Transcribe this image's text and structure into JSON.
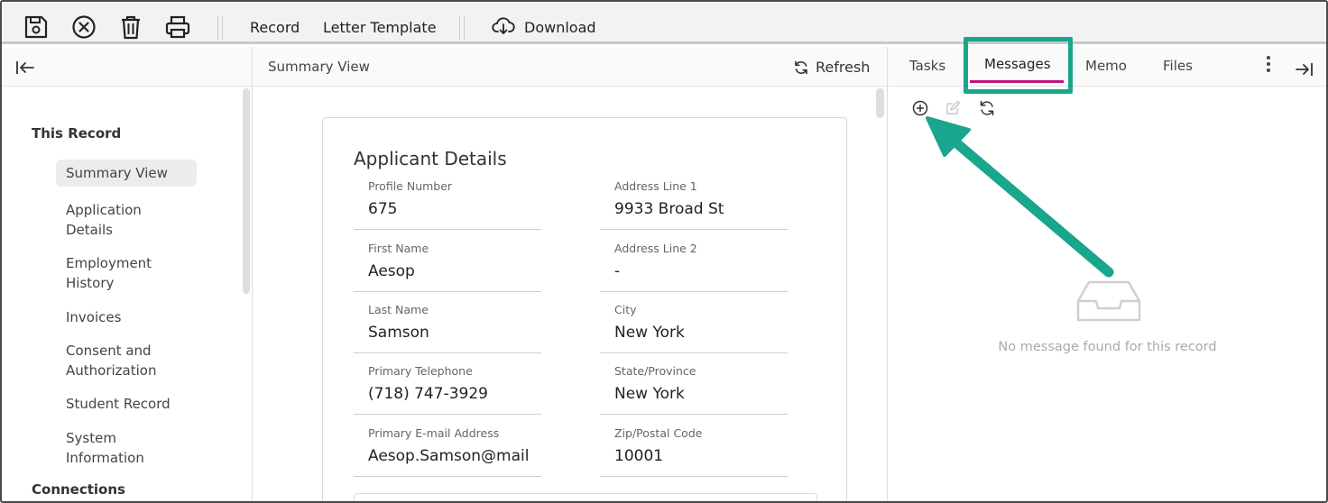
{
  "toolbar": {
    "icons": [
      "save-icon",
      "cancel-icon",
      "trash-icon",
      "print-icon",
      "cloud-download-icon"
    ],
    "record_label": "Record",
    "letter_template_label": "Letter Template",
    "download_label": "Download"
  },
  "sidebar": {
    "sections": [
      {
        "label": "This Record"
      },
      {
        "label": "Connections"
      }
    ],
    "items": [
      {
        "label": "Summary View",
        "active": true
      },
      {
        "label": "Application\nDetails"
      },
      {
        "label": "Employment\nHistory"
      },
      {
        "label": "Invoices"
      },
      {
        "label": "Consent and\nAuthorization"
      },
      {
        "label": "Student Record"
      },
      {
        "label": "System\nInformation"
      }
    ]
  },
  "main": {
    "title": "Summary View",
    "refresh_label": "Refresh",
    "card": {
      "title": "Applicant Details",
      "fields": [
        {
          "label": "Profile Number",
          "value": "675"
        },
        {
          "label": "Address Line 1",
          "value": "9933 Broad St"
        },
        {
          "label": "First Name",
          "value": "Aesop"
        },
        {
          "label": "Address Line 2",
          "value": "-"
        },
        {
          "label": "Last Name",
          "value": "Samson"
        },
        {
          "label": "City",
          "value": "New York"
        },
        {
          "label": "Primary Telephone",
          "value": "(718) 747-3929"
        },
        {
          "label": "State/Province",
          "value": "New York"
        },
        {
          "label": "Primary E-mail Address",
          "value": "Aesop.Samson@mailinc"
        },
        {
          "label": "Zip/Postal Code",
          "value": "10001"
        }
      ]
    }
  },
  "right_panel": {
    "tabs": [
      {
        "label": "Tasks"
      },
      {
        "label": "Messages",
        "active": true
      },
      {
        "label": "Memo"
      },
      {
        "label": "Files"
      }
    ],
    "empty_message": "No message found for this record"
  },
  "colors": {
    "highlight": "#1aa58d",
    "active_tab_underline": "#c2127d",
    "arrow": "#1aa58d"
  }
}
